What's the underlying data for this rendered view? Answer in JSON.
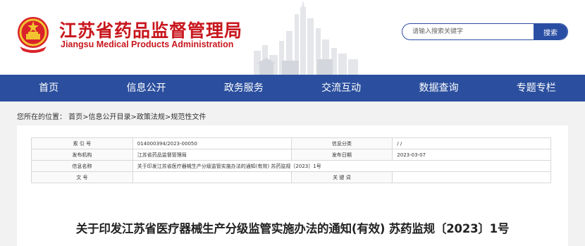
{
  "header": {
    "title_cn": "江苏省药品监督管理局",
    "title_en": "Jiangsu Medical Products Administration",
    "emblem_icon": "national-emblem-icon",
    "brand_color": "#c8161d"
  },
  "search": {
    "placeholder": "请输入搜索关键字",
    "button_label": "搜索",
    "accent_color": "#2a4ea3"
  },
  "nav": {
    "items": [
      {
        "label": "首页"
      },
      {
        "label": "信息公开"
      },
      {
        "label": "政务服务"
      },
      {
        "label": "交流互动"
      },
      {
        "label": "数据查询"
      },
      {
        "label": "专题专栏"
      }
    ],
    "background": "#2b4f9e"
  },
  "breadcrumb": "您所在的位置： 首页>信息公开目录>政策法规>规范性文件",
  "meta": {
    "rows": [
      {
        "l1": "索 引 号",
        "v1": "014000394/2023-00050",
        "l2": "信息分类",
        "v2": "/    /"
      },
      {
        "l1": "发布机构",
        "v1": "江苏省药品监督管理局",
        "l2": "发布日期",
        "v2": "2023-03-07"
      },
      {
        "l1": "信息名称",
        "v_full": "关于印发江苏省医疗器械生产分级监管实施办法的通知(有效) 苏药监规〔2023〕1号"
      },
      {
        "l1": "文    号",
        "v1": "",
        "l2": "关 键 词",
        "v2": ""
      }
    ]
  },
  "article": {
    "title": "关于印发江苏省医疗器械生产分级监管实施办法的通知(有效) 苏药监规〔2023〕1号"
  }
}
